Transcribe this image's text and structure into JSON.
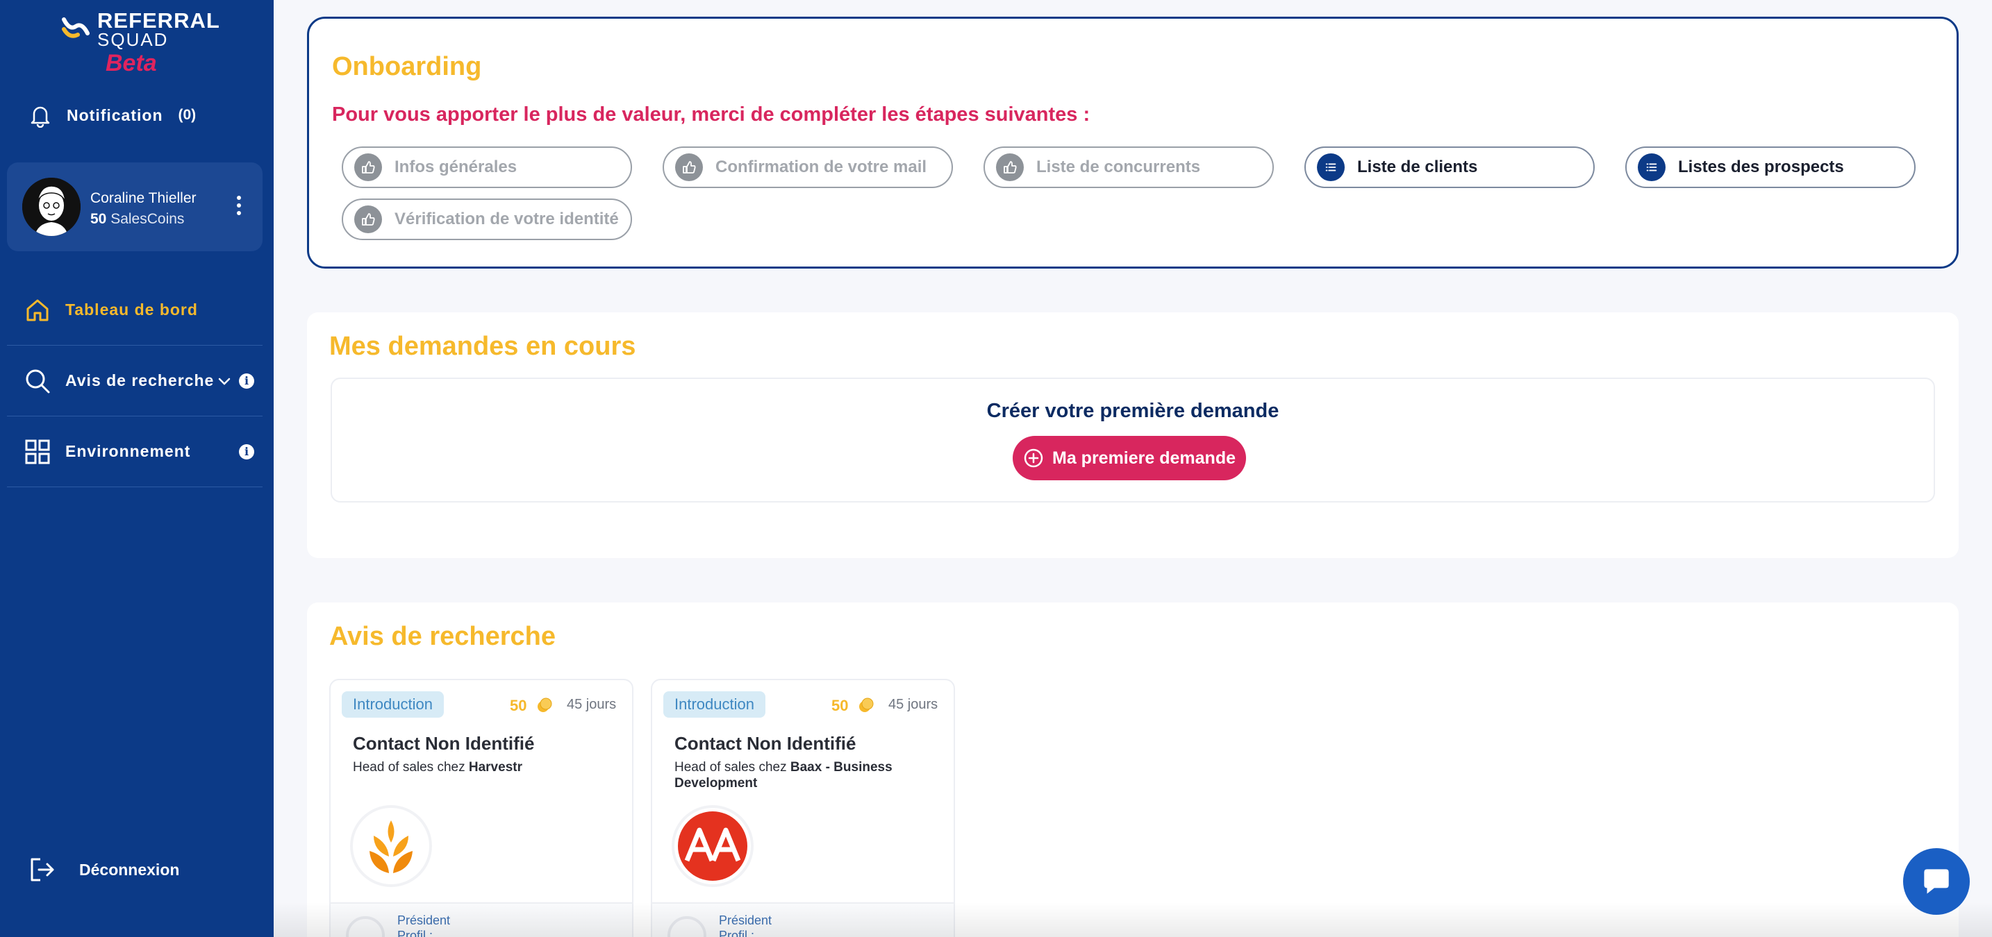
{
  "brand": {
    "line1": "REFERRAL",
    "line2": "SQUAD",
    "line3": "Beta"
  },
  "sidebar": {
    "notification": {
      "label": "Notification",
      "count": "(0)",
      "icon": "bell-icon"
    },
    "profile": {
      "name": "Coraline Thieller",
      "coins_value": "50",
      "coins_label": "SalesCoins"
    },
    "items": [
      {
        "label": "Tableau de bord",
        "icon": "home-icon",
        "active": true
      },
      {
        "label": "Avis de recherche",
        "icon": "search-icon",
        "info": "i"
      },
      {
        "label": "Environnement",
        "icon": "grid-icon",
        "info": "i"
      }
    ],
    "logout": {
      "label": "Déconnexion",
      "icon": "logout-icon"
    }
  },
  "onboarding": {
    "title": "Onboarding",
    "subtitle": "Pour vous apporter le plus de valeur, merci de compléter les étapes suivantes :",
    "steps": [
      {
        "label": "Infos générales",
        "status": "done",
        "icon": "thumbs-up-icon"
      },
      {
        "label": "Confirmation de votre mail",
        "status": "done",
        "icon": "thumbs-up-icon"
      },
      {
        "label": "Liste de concurrents",
        "status": "done",
        "icon": "thumbs-up-icon"
      },
      {
        "label": "Liste de clients",
        "status": "todo",
        "icon": "list-icon"
      },
      {
        "label": "Listes des prospects",
        "status": "todo",
        "icon": "list-icon"
      },
      {
        "label": "Vérification de votre identité",
        "status": "done",
        "icon": "thumbs-up-icon"
      }
    ]
  },
  "demandes": {
    "title": "Mes demandes en cours",
    "create_label": "Créer votre première demande",
    "button_label": "Ma premiere demande"
  },
  "avis": {
    "title": "Avis de recherche",
    "cards": [
      {
        "tag": "Introduction",
        "points": "50",
        "days": "45 jours",
        "contact": "Contact Non Identifié",
        "role_prefix": "Head of sales chez",
        "company": "Harvestr",
        "footer_title": "Président",
        "footer_sub": "Profil :"
      },
      {
        "tag": "Introduction",
        "points": "50",
        "days": "45 jours",
        "contact": "Contact Non Identifié",
        "role_prefix": "Head of sales chez",
        "company": "Baax - Business Development",
        "footer_title": "Président",
        "footer_sub": "Profil :"
      }
    ]
  },
  "colors": {
    "sidebar": "#0c3a87",
    "accent_yellow": "#f6b92c",
    "accent_pink": "#d8265e"
  }
}
